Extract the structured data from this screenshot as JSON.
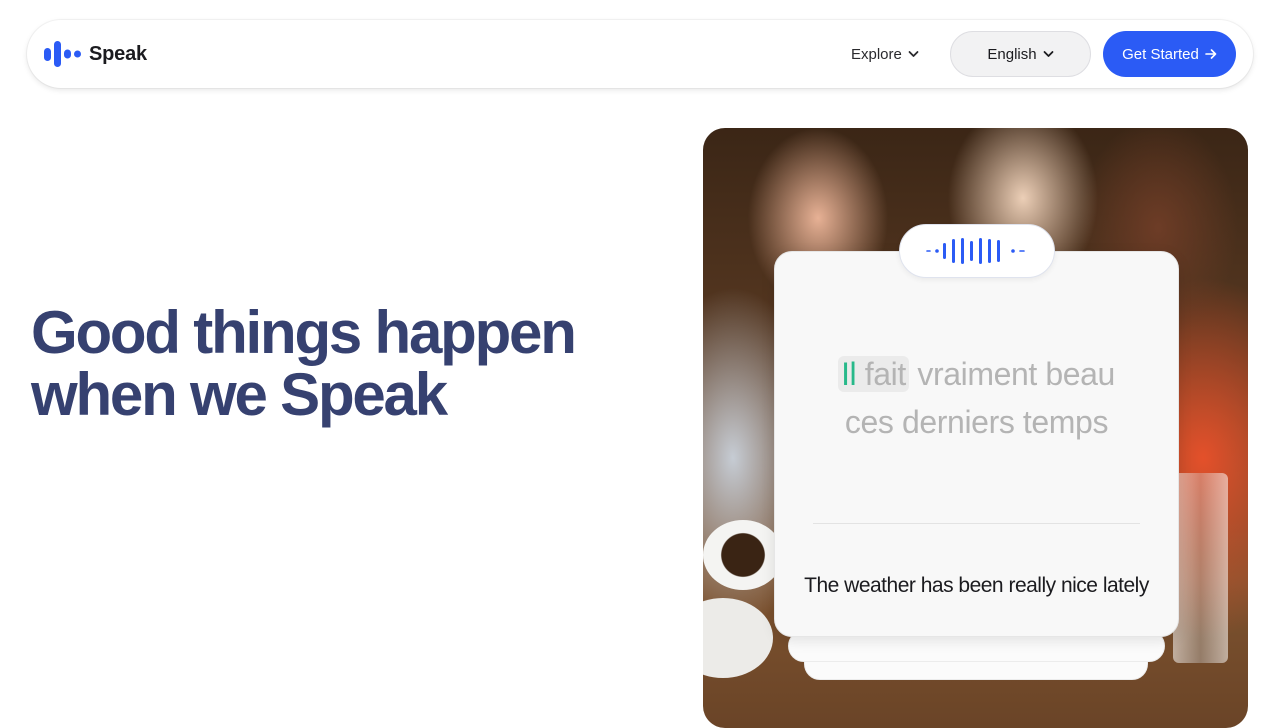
{
  "brand": {
    "name": "Speak",
    "color": "#2b5bf5"
  },
  "nav": {
    "explore_label": "Explore",
    "language_label": "English",
    "cta_label": "Get Started"
  },
  "hero": {
    "title_line1": "Good things happen",
    "title_line2": "when we Speak"
  },
  "card": {
    "fr_highlight_prefix": "Il",
    "fr_highlight_rest": " fait",
    "fr_line1_rest": " vraiment beau",
    "fr_line2": "ces derniers temps",
    "en_text": "The weather has been really nice lately"
  },
  "colors": {
    "heading": "#364170",
    "highlight_green": "#27b98a",
    "cta_bg": "#2b5bf5"
  },
  "icons": [
    "speak-logo-icon",
    "chevron-down-icon",
    "arrow-right-icon",
    "audio-waveform-icon"
  ]
}
